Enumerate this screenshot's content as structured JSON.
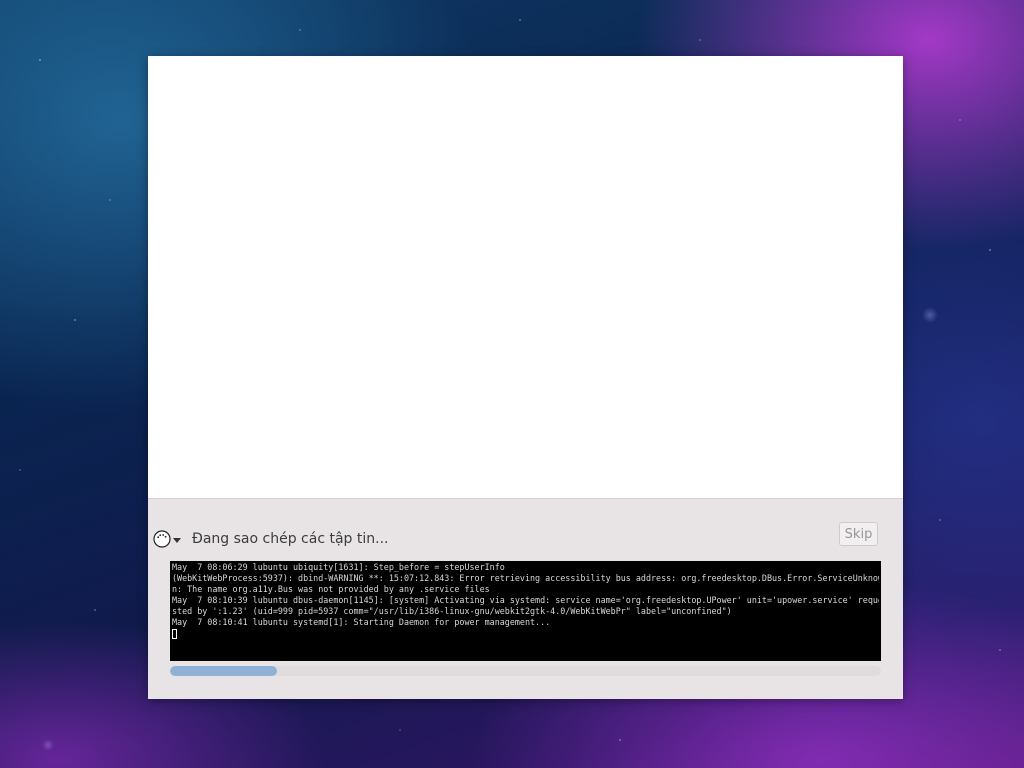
{
  "installer": {
    "status_text": "Đang sao chép các tập tin...",
    "skip_label": "Skip",
    "progress": 0.15,
    "log_lines": [
      "May  7 08:06:29 lubuntu ubiquity[1631]: Step_before = stepUserInfo",
      "",
      "(WebKitWebProcess:5937): dbind-WARNING **: 15:07:12.843: Error retrieving accessibility bus address: org.freedesktop.DBus.Error.ServiceUnknow",
      "n: The name org.a11y.Bus was not provided by any .service files",
      "May  7 08:10:39 lubuntu dbus-daemon[1145]: [system] Activating via systemd: service name='org.freedesktop.UPower' unit='upower.service' reque",
      "sted by ':1.23' (uid=999 pid=5937 comm=\"/usr/lib/i386-linux-gnu/webkit2gtk-4.0/WebKitWebPr\" label=\"unconfined\")",
      "May  7 08:10:41 lubuntu systemd[1]: Starting Daemon for power management..."
    ]
  },
  "colors": {
    "terminal_bg": "#000000",
    "terminal_text": "#d8d8d8",
    "progress_fill": "#8fb2d4",
    "window_bg": "#e8e4e6"
  },
  "icons": {
    "toggle": "spinner-icon",
    "expander": "triangle-down-icon"
  }
}
